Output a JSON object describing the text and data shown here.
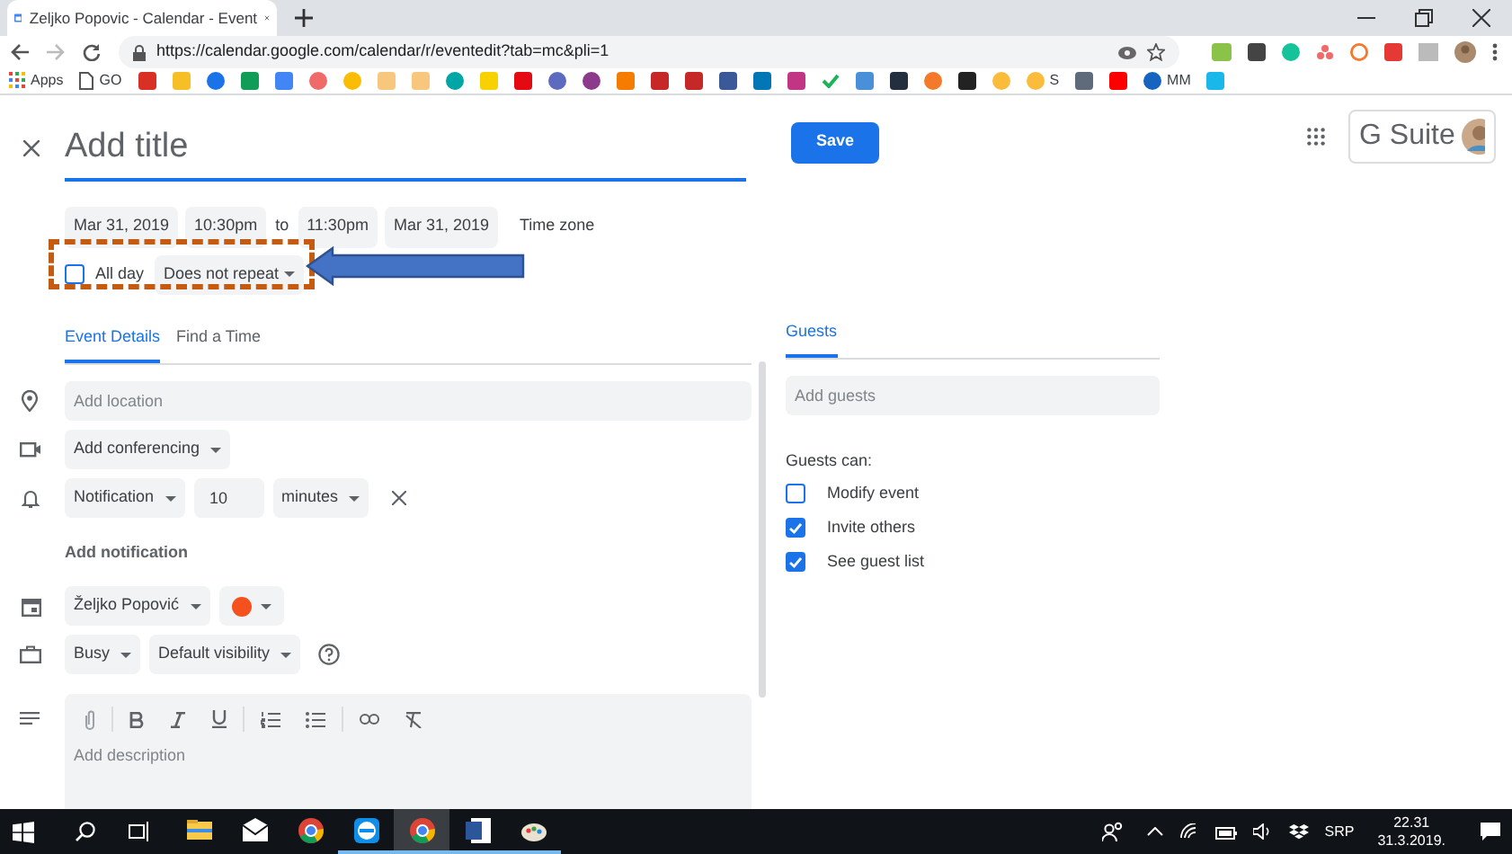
{
  "browser": {
    "tab_title": "Zeljko Popovic - Calendar - Event",
    "url": "https://calendar.google.com/calendar/r/eventedit?tab=mc&pli=1",
    "bookmarks": [
      {
        "kind": "apps",
        "label": "Apps"
      },
      {
        "kind": "page",
        "label": "GO"
      },
      {
        "kind": "icon",
        "color": "#d93025"
      },
      {
        "kind": "icon",
        "color": "#f6bf26"
      },
      {
        "kind": "circle",
        "color": "#1a73e8"
      },
      {
        "kind": "icon",
        "color": "#0f9d58"
      },
      {
        "kind": "icon",
        "color": "#4285f4"
      },
      {
        "kind": "circle",
        "color": "#f06a6a"
      },
      {
        "kind": "circle",
        "color": "#fbbc04"
      },
      {
        "kind": "icon",
        "color": "#f8c77e"
      },
      {
        "kind": "icon",
        "color": "#f8c77e"
      },
      {
        "kind": "circle",
        "color": "#00a6a6"
      },
      {
        "kind": "icon",
        "color": "#f7d100"
      },
      {
        "kind": "icon",
        "color": "#e50914"
      },
      {
        "kind": "circle",
        "color": "#5c6bc0"
      },
      {
        "kind": "circle",
        "color": "#8e3a8c"
      },
      {
        "kind": "icon",
        "color": "#f57c00"
      },
      {
        "kind": "icon",
        "color": "#c62828"
      },
      {
        "kind": "icon",
        "color": "#c62828"
      },
      {
        "kind": "icon",
        "color": "#3b5998"
      },
      {
        "kind": "icon",
        "color": "#0077b5"
      },
      {
        "kind": "icon",
        "color": "#c13584"
      },
      {
        "kind": "check",
        "color": "#1fb25a"
      },
      {
        "kind": "icon",
        "color": "#4a90d9"
      },
      {
        "kind": "icon",
        "color": "#232f3e"
      },
      {
        "kind": "circle",
        "color": "#f4792b"
      },
      {
        "kind": "icon",
        "color": "#222222"
      },
      {
        "kind": "circle",
        "color": "#fbbc3c"
      },
      {
        "kind": "circle",
        "color": "#fbbc3c",
        "label": "S"
      },
      {
        "kind": "icon",
        "color": "#5f6b7a"
      },
      {
        "kind": "icon",
        "color": "#ff0000"
      },
      {
        "kind": "circle",
        "color": "#1565c0",
        "label": "MM"
      },
      {
        "kind": "icon",
        "color": "#1ab7ea"
      }
    ]
  },
  "event": {
    "title_placeholder": "Add title",
    "save": "Save",
    "brand": "G Suite",
    "start_date": "Mar 31, 2019",
    "start_time": "10:30pm",
    "to": "to",
    "end_time": "11:30pm",
    "end_date": "Mar 31, 2019",
    "time_zone": "Time zone",
    "all_day": {
      "label": "All day",
      "checked": false
    },
    "repeat": "Does not repeat",
    "tabs": [
      {
        "label": "Event Details",
        "selected": true
      },
      {
        "label": "Find a Time",
        "selected": false
      }
    ],
    "location_placeholder": "Add location",
    "conferencing": "Add conferencing",
    "notification": {
      "type": "Notification",
      "value": "10",
      "unit": "minutes"
    },
    "add_notification": "Add notification",
    "calendar": {
      "owner": "Željko Popović",
      "color": "#f4511e"
    },
    "availability": "Busy",
    "visibility": "Default visibility",
    "description_placeholder": "Add description"
  },
  "guests": {
    "tab": {
      "label": "Guests",
      "selected": true
    },
    "placeholder": "Add guests",
    "permissions_title": "Guests can:",
    "permissions": [
      {
        "label": "Modify event",
        "checked": false
      },
      {
        "label": "Invite others",
        "checked": true
      },
      {
        "label": "See guest list",
        "checked": true
      }
    ]
  },
  "taskbar": {
    "apps": [
      {
        "kind": "explorer",
        "running": false,
        "selected": false
      },
      {
        "kind": "mail",
        "running": false,
        "selected": false
      },
      {
        "kind": "chrome",
        "running": false,
        "selected": false
      },
      {
        "kind": "teamviewer",
        "running": true,
        "selected": false
      },
      {
        "kind": "chrome",
        "running": true,
        "selected": true
      },
      {
        "kind": "word",
        "running": true,
        "selected": false
      },
      {
        "kind": "paint",
        "running": true,
        "selected": false
      }
    ],
    "language": "SRP",
    "time": "22.31",
    "date": "31.3.2019."
  }
}
